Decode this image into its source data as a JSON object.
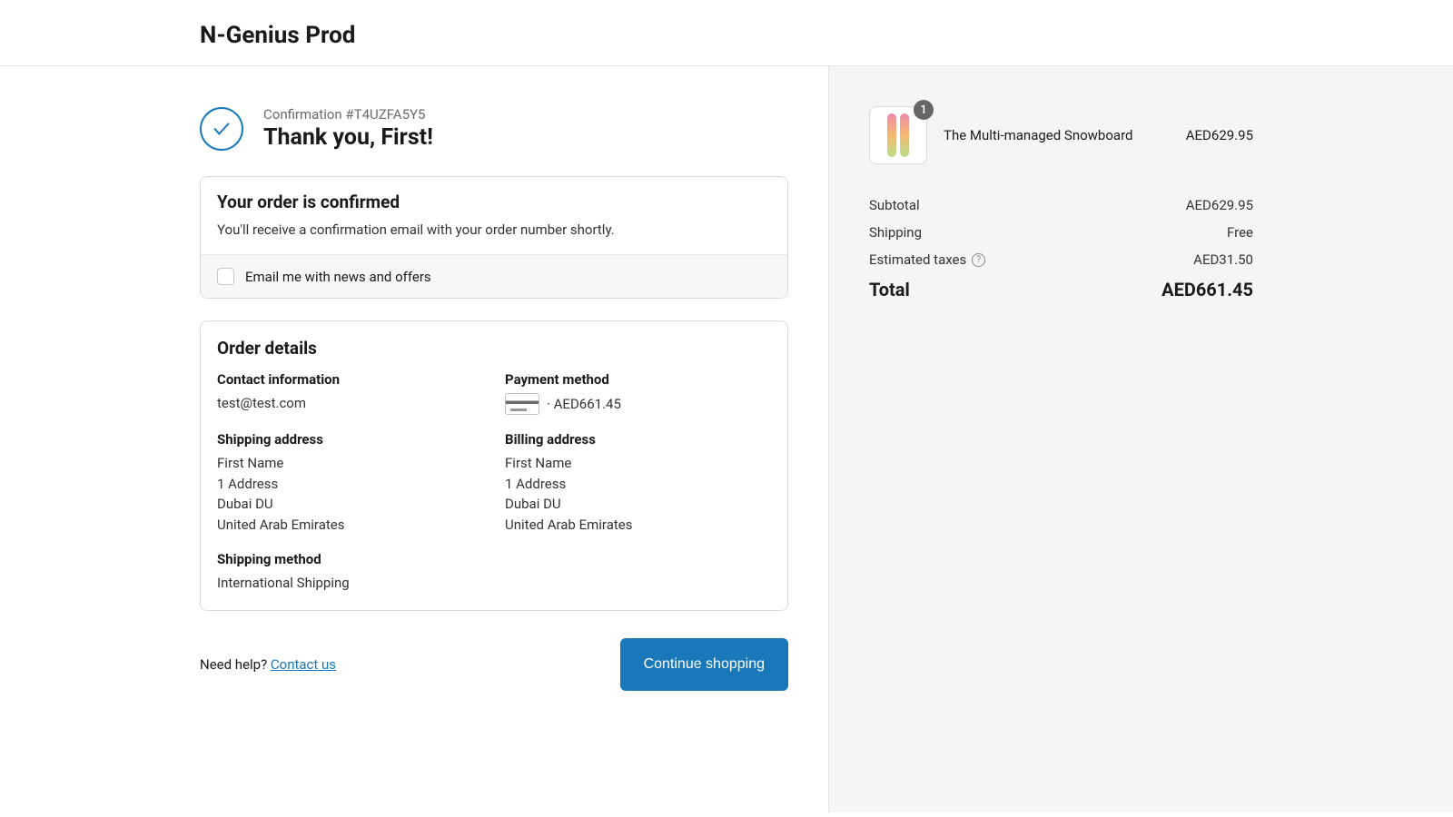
{
  "store_name": "N-Genius Prod",
  "confirmation": {
    "number_label": "Confirmation #T4UZFA5Y5",
    "heading": "Thank you, First!"
  },
  "confirmed_card": {
    "title": "Your order is confirmed",
    "text": "You'll receive a confirmation email with your order number shortly.",
    "subscribe_label": "Email me with news and offers"
  },
  "details": {
    "title": "Order details",
    "contact_label": "Contact information",
    "contact_email": "test@test.com",
    "payment_label": "Payment method",
    "payment_amount": " · AED661.45",
    "shipping_addr_label": "Shipping address",
    "shipping_addr": {
      "line1": "First Name",
      "line2": "1 Address",
      "line3": "Dubai DU",
      "line4": "United Arab Emirates"
    },
    "billing_addr_label": "Billing address",
    "billing_addr": {
      "line1": "First Name",
      "line2": "1 Address",
      "line3": "Dubai DU",
      "line4": "United Arab Emirates"
    },
    "shipping_method_label": "Shipping method",
    "shipping_method": "International Shipping"
  },
  "footer": {
    "help_prefix": "Need help? ",
    "contact_link": "Contact us",
    "continue_btn": "Continue shopping"
  },
  "order_summary": {
    "product": {
      "qty": "1",
      "name": "The Multi-managed Snowboard",
      "price": "AED629.95"
    },
    "subtotal_label": "Subtotal",
    "subtotal_value": "AED629.95",
    "shipping_label": "Shipping",
    "shipping_value": "Free",
    "taxes_label": "Estimated taxes",
    "taxes_value": "AED31.50",
    "total_label": "Total",
    "total_value": "AED661.45"
  }
}
